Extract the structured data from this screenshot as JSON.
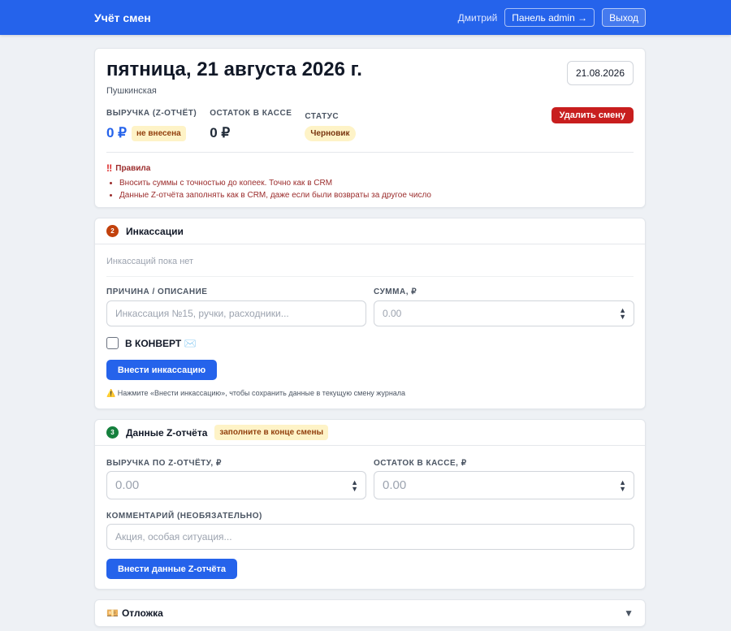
{
  "topbar": {
    "brand": "Учёт смен",
    "user": "Дмитрий",
    "admin_label": "Панель admin →",
    "logout_label": "Выход"
  },
  "shift": {
    "title": "пятница, 21 августа 2026 г.",
    "location": "Пушкинская",
    "date": "21.08.2026",
    "revenue_label": "Выручка (Z-отчёт)",
    "revenue_value": "0 ₽",
    "revenue_badge": "не внесена",
    "cash_label": "Остаток в кассе",
    "cash_value": "0 ₽",
    "status_label": "Статус",
    "status_value": "Черновик",
    "delete_label": "Удалить смену",
    "rules_title": "Правила",
    "rules": [
      "Вносить суммы с точностью до копеек. Точно как в CRM",
      "Данные Z-отчёта заполнять как в CRM, даже если были возвраты за другое число"
    ]
  },
  "collections": {
    "number": "2",
    "title": "Инкассации",
    "empty_text": "Инкассаций пока нет",
    "reason_label": "Причина / описание",
    "reason_placeholder": "Инкассация №15, ручки, расходники...",
    "amount_label": "Сумма, ₽",
    "amount_placeholder": "0.00",
    "envelope_label": "В КОНВЕРТ ✉️",
    "submit_label": "Внести инкассацию",
    "hint": "⚠️ Нажмите «Внести инкассацию», чтобы сохранить данные в текущую смену журнала"
  },
  "zreport": {
    "number": "3",
    "title": "Данные Z-отчёта",
    "badge": "заполните в конце смены",
    "revenue_label": "Выручка по Z-отчёту, ₽",
    "revenue_placeholder": "0.00",
    "cash_label": "Остаток в кассе, ₽",
    "cash_placeholder": "0.00",
    "comment_label": "Комментарий (необязательно)",
    "comment_placeholder": "Акция, особая ситуация...",
    "submit_label": "Внести данные Z-отчёта"
  },
  "deferral": {
    "icon": "💴",
    "title": "Отложка",
    "arrow": "▼"
  }
}
